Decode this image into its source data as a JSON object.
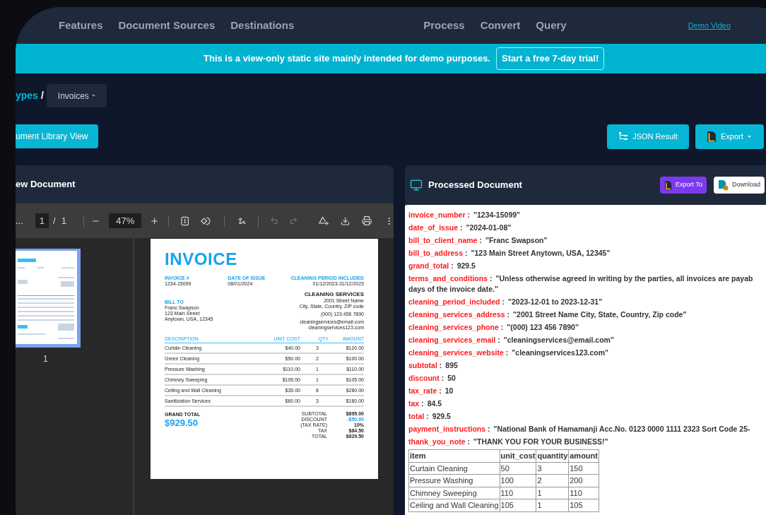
{
  "nav": {
    "left_links": [
      "Features",
      "Document Sources",
      "Destinations"
    ],
    "center_links": [
      "Process",
      "Convert",
      "Query"
    ],
    "demo_link": "Demo Video"
  },
  "banner": {
    "text": "This is a view-only static site mainly intended for demo purposes.",
    "button": "Start a free 7-day trial!"
  },
  "breadcrumb": {
    "parent": "ypes",
    "separator": "/",
    "current": "Invoices"
  },
  "library_button": "ument Library View",
  "actions": [
    {
      "label": "JSON Result",
      "kind": "json"
    },
    {
      "label": "Export",
      "kind": "export"
    }
  ],
  "viewer": {
    "title": "ew Document",
    "overflow": "...",
    "page": "1",
    "page_separator": "/",
    "page_count": "1",
    "zoom": "47%",
    "thumbnail_label": "1"
  },
  "invoice": {
    "title": "INVOICE",
    "meta": [
      {
        "label": "INVOICE #",
        "value": "1234-15099"
      },
      {
        "label": "DATE OF ISSUE",
        "value": "08/01/2024"
      },
      {
        "label": "CLEANING PERIOD INCLUDED",
        "value": "01/12/2023-31/12/2023"
      }
    ],
    "bill_to_label": "BILL TO",
    "bill_to_lines": [
      "Franc Swapson",
      "123 Main Street",
      "Anytown, USA, 12345"
    ],
    "company": "CLEANING SERVICES",
    "company_lines": [
      "2001 Street Name",
      "City, State, Country, ZIP code"
    ],
    "phone": "(000) 123 456 7890",
    "web_lines": [
      "cleaningservices@email.com",
      "cleaningservices123.com"
    ],
    "columns": [
      "DESCRIPTION",
      "UNIT COST",
      "QTY",
      "AMOUNT"
    ],
    "rows": [
      [
        "Curtain Cleaning",
        "$40.00",
        "3",
        "$120.00"
      ],
      [
        "Green Cleaning",
        "$50.00",
        "2",
        "$100.00"
      ],
      [
        "Pressure Washing",
        "$110.00",
        "1",
        "$110.00"
      ],
      [
        "Chimney Sweeping",
        "$105.00",
        "1",
        "$105.00"
      ],
      [
        "Ceiling and Wall Cleaning",
        "$35.00",
        "8",
        "$280.00"
      ],
      [
        "Sanitization Services",
        "$60.00",
        "3",
        "$180.00"
      ]
    ],
    "grand_total_label": "GRAND TOTAL",
    "grand_total": "$929.50",
    "totals": [
      {
        "label": "SUBTOTAL",
        "value": "$895.00",
        "highlight": false
      },
      {
        "label": "DISCOUNT",
        "value": "-$50.00",
        "highlight": true
      },
      {
        "label": "(TAX RATE)",
        "value": "10%",
        "highlight": false
      },
      {
        "label": "TAX",
        "value": "$84.50",
        "highlight": false
      },
      {
        "label": "TOTAL",
        "value": "$929.50",
        "highlight": false
      }
    ]
  },
  "processed": {
    "title": "Processed Document",
    "buttons": [
      {
        "label": "Export To",
        "kind": "export"
      },
      {
        "label": "Download",
        "kind": "download"
      }
    ],
    "fields": [
      {
        "key": "invoice_number",
        "separator": ":",
        "value": "\"1234-15099\""
      },
      {
        "key": "date_of_issue",
        "separator": ":",
        "value": "\"2024-01-08\""
      },
      {
        "key": "bill_to_client_name",
        "separator": ":",
        "value": "\"Franc Swapson\""
      },
      {
        "key": "bill_to_address",
        "separator": ":",
        "value": "\"123 Main Street Anytown, USA, 12345\""
      },
      {
        "key": "grand_total",
        "separator": ":",
        "value": "929.5"
      },
      {
        "key": "terms_and_conditions",
        "separator": ":",
        "value": "\"Unless otherwise agreed in writing by the parties, all invoices are payab",
        "continuation": "days of the invoice date.\""
      },
      {
        "key": "cleaning_period_included",
        "separator": ":",
        "value": "\"2023-12-01 to 2023-12-31\""
      },
      {
        "key": "cleaning_services_address",
        "separator": ":",
        "value": "\"2001 Street Name City, State, Country, Zip code\""
      },
      {
        "key": "cleaning_services_phone",
        "separator": ":",
        "value": "\"(000) 123 456 7890\""
      },
      {
        "key": "cleaning_services_email",
        "separator": ":",
        "value": "\"cleaningservices@email.com\""
      },
      {
        "key": "cleaning_services_website",
        "separator": ":",
        "value": "\"cleaningservices123.com\""
      },
      {
        "key": "subtotal",
        "separator": ":",
        "value": "895"
      },
      {
        "key": "discount",
        "separator": ":",
        "value": "50"
      },
      {
        "key": "tax_rate",
        "separator": ":",
        "value": "10"
      },
      {
        "key": "tax",
        "separator": ":",
        "value": "84.5"
      },
      {
        "key": "total",
        "separator": ":",
        "value": "929.5"
      },
      {
        "key": "payment_instructions",
        "separator": ":",
        "value": "\"National Bank of Hamamanji Acc.No. 0123 0000 1111 2323 Sort Code 25-"
      },
      {
        "key": "thank_you_note",
        "separator": ":",
        "value": "\"THANK YOU FOR YOUR BUSINESS!\""
      }
    ],
    "table": {
      "columns": [
        "item",
        "unit_cost",
        "quantity",
        "amount"
      ],
      "rows": [
        [
          "Curtain Cleaning",
          "50",
          "3",
          "150"
        ],
        [
          "Pressure Washing",
          "100",
          "2",
          "200"
        ],
        [
          "Chimney Sweeping",
          "110",
          "1",
          "110"
        ],
        [
          "Ceiling and Wall Cleaning",
          "105",
          "1",
          "105"
        ]
      ]
    }
  }
}
